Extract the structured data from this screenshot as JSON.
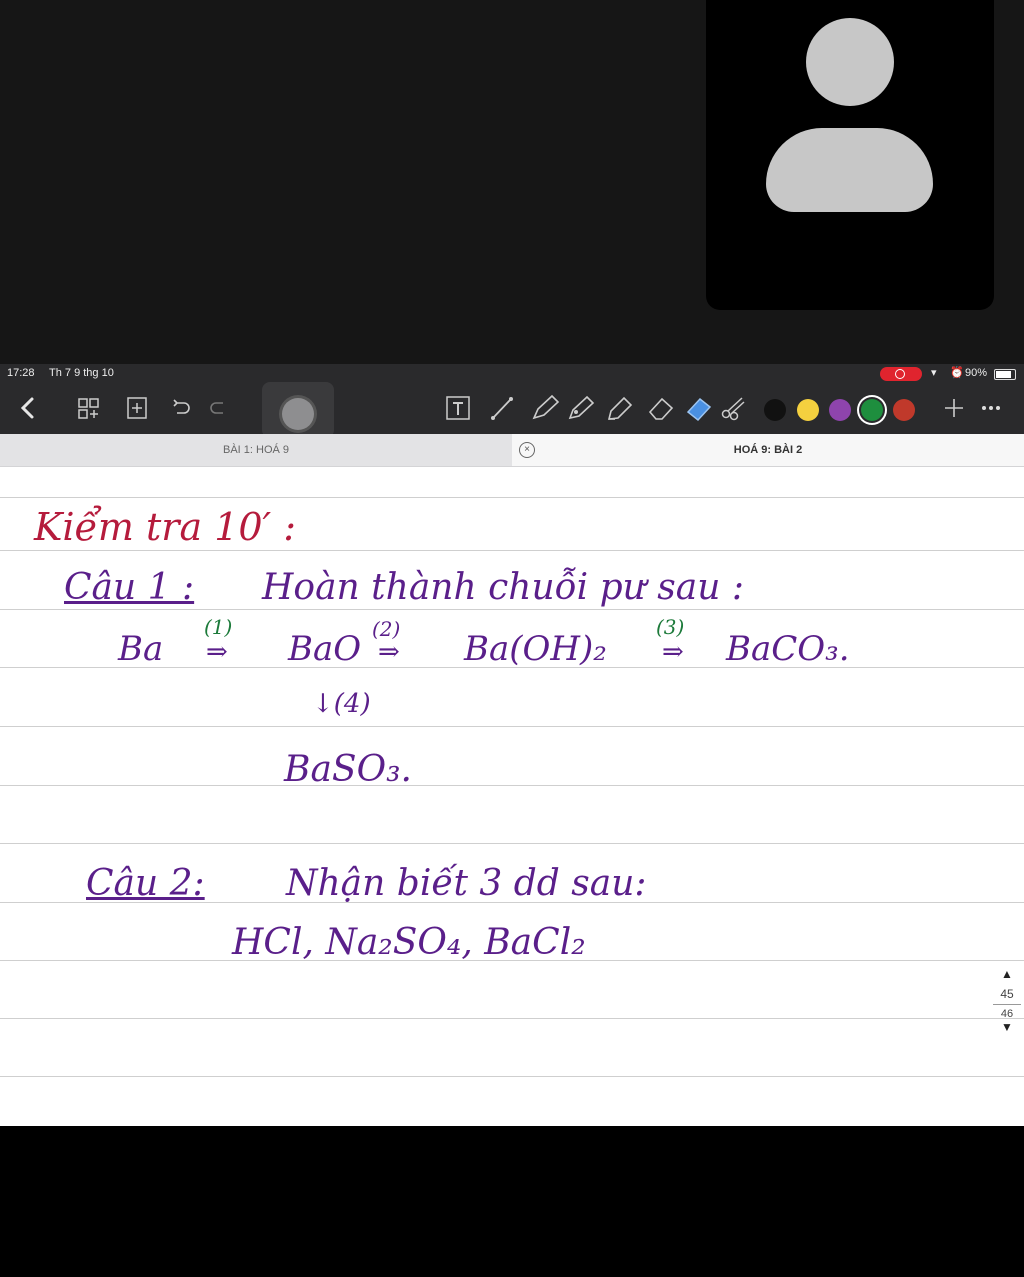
{
  "status": {
    "time": "17:28",
    "date": "Th 7 9 thg 10",
    "battery": "90%",
    "battery_level": 0.9
  },
  "toolbar": {
    "icons": [
      "back-icon",
      "thumbnails-icon",
      "add-page-icon",
      "undo-icon",
      "redo-icon",
      "text-tool-icon",
      "line-tool-icon",
      "pen-icon",
      "pencil-icon",
      "highlighter-icon",
      "eraser-icon",
      "lasso-icon",
      "scissors-icon",
      "add-icon",
      "more-icon"
    ],
    "colors": [
      "#111111",
      "#f4d03f",
      "#8e44ad",
      "#1e8e3e",
      "#c0392b"
    ],
    "selected_color": "#1e8e3e"
  },
  "tabs": {
    "left": "BÀI 1: HOÁ 9",
    "right": "HOÁ 9: BÀI 2"
  },
  "note": {
    "heading": "Kiểm tra 10′ :",
    "q1_label": "Câu 1 :",
    "q1_text": "Hoàn thành chuỗi pư sau :",
    "chain": {
      "ba": "Ba",
      "s1": "(1)",
      "bao": "BaO",
      "s2": "(2)",
      "baoh2": "Ba(OH)₂",
      "s3": "(3)",
      "baco3": "BaCO₃.",
      "s4": "↓(4)",
      "baso3": "BaSO₃."
    },
    "q2_label": "Câu 2:",
    "q2_text": "Nhận biết 3 dd sau:",
    "q2_items": "HCl, Na₂SO₄, BaCl₂"
  },
  "pager": {
    "page_a": "45",
    "page_b": "46"
  }
}
